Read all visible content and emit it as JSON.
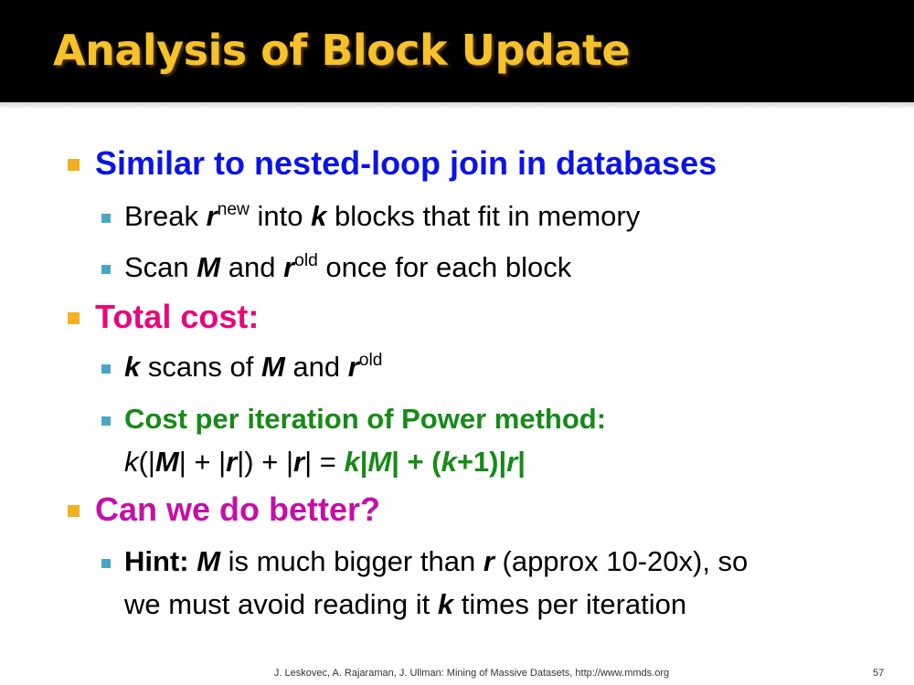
{
  "title": "Analysis of Block Update",
  "b1": {
    "text": "Similar to nested-loop join in databases"
  },
  "b1a": {
    "pre": "Break ",
    "r": "r",
    "sup": "new",
    "mid": " into ",
    "k": "k",
    "post": " blocks that fit in memory"
  },
  "b1b": {
    "pre": "Scan ",
    "M": "M",
    "mid": " and ",
    "r": "r",
    "sup": "old",
    "post": " once for each block"
  },
  "b2": {
    "text": "Total cost:"
  },
  "b2a": {
    "k": "k",
    "t1": " scans of ",
    "M": "M",
    "t2": " and ",
    "r": "r",
    "sup": "old"
  },
  "b2b": {
    "line1": "Cost per iteration of Power method:",
    "k1": "k",
    "p1": "(|",
    "M1": "M",
    "p2": "| + |",
    "r1": "r",
    "p3": "|) + |",
    "r2": "r",
    "p4": "| = ",
    "k2": "k",
    "g1": "|",
    "M2": "M",
    "g2": "| + (",
    "k3": "k",
    "g3": "+1)|",
    "r3": "r",
    "g4": "|"
  },
  "b3": {
    "text": "Can we do better?"
  },
  "b3a": {
    "hint": "Hint:",
    "sp": " ",
    "M": "M",
    "t1": " is much bigger than ",
    "r": "r",
    "t2": " (approx 10-20x), so",
    "line2a": "we must avoid reading it ",
    "k": "k",
    "line2b": " times per iteration"
  },
  "footer": {
    "text": "J. Leskovec, A. Rajaraman, J. Ullman: Mining of Massive Datasets, http://www.mmds.org",
    "page": "57"
  },
  "colors": {
    "title": "#f6c12b",
    "blue": "#0a14e6",
    "pink": "#e6087a",
    "magenta": "#c40fa8",
    "green": "#178a17",
    "bullet_main": "#f0b022",
    "bullet_sub": "#4aa5c7"
  }
}
